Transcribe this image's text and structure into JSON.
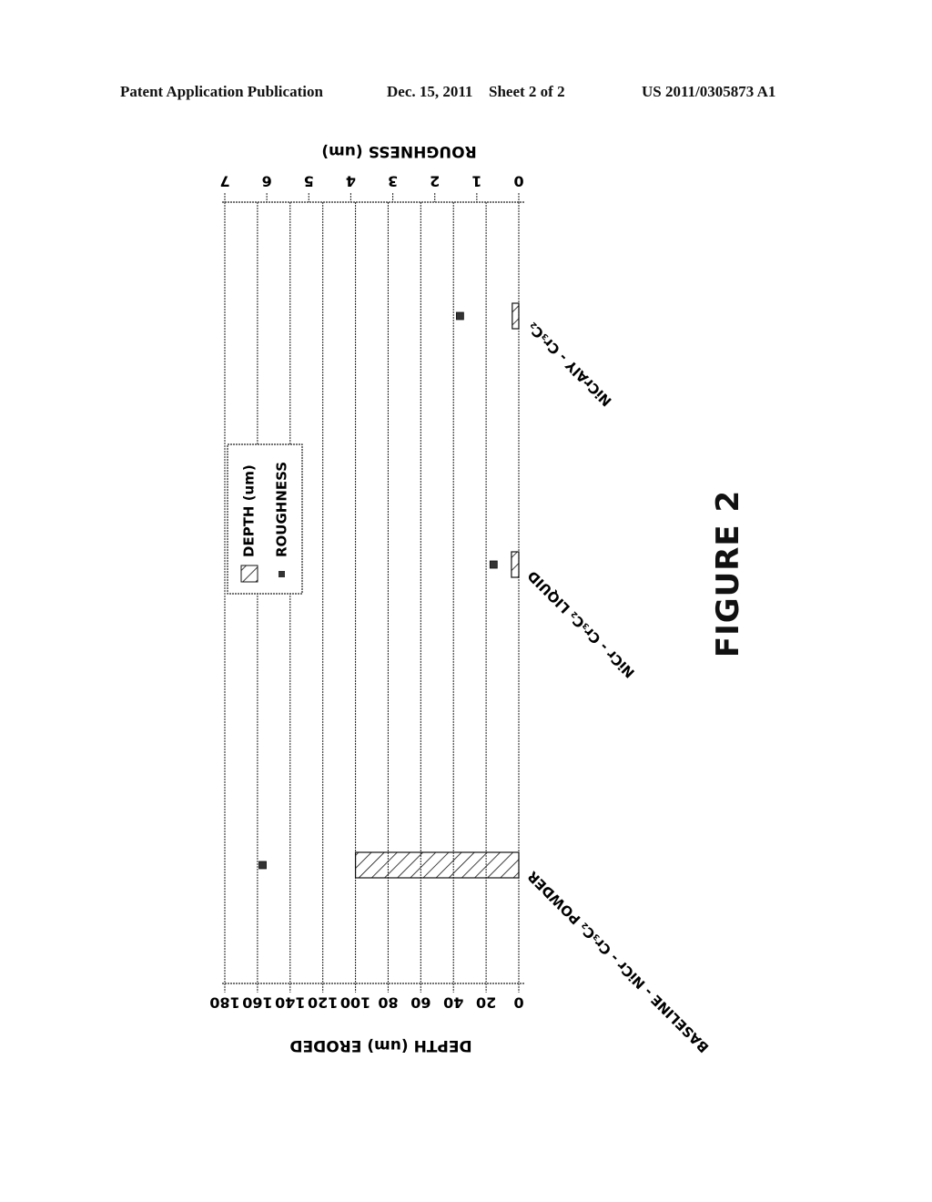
{
  "header": {
    "left": "Patent Application Publication",
    "date": "Dec. 15, 2011",
    "sheet": "Sheet 2 of 2",
    "pub_number": "US 2011/0305873 A1"
  },
  "figure_label": "FIGURE 2",
  "chart_data": {
    "type": "bar",
    "orientation": "rotated-90 (bars horizontal on page, axes on top/bottom)",
    "categories": [
      "BASELINE - NiCr - Cr3C2 POWDER",
      "NiCr - Cr3C2 LIQUID",
      "NiCrAlY - Cr3C2"
    ],
    "category_labels_display": [
      "BASELINE - NiCr - Cr₃C₂ POWDER",
      "NiCr - Cr₃C₂ LIQUID",
      "NiCrAlY - Cr₃C₂"
    ],
    "series": [
      {
        "name": "DEPTH (um)",
        "type": "bar",
        "axis": "primary",
        "pattern": "diagonal-hatch",
        "values": [
          100,
          4.5,
          4
        ]
      },
      {
        "name": "ROUGHNESS",
        "type": "scatter",
        "axis": "secondary",
        "marker": "square",
        "values": [
          6.1,
          0.6,
          1.4
        ]
      }
    ],
    "primary_axis": {
      "label": "DEPTH (um) ERODED",
      "range": [
        0,
        180
      ],
      "ticks": [
        0,
        20,
        40,
        60,
        80,
        100,
        120,
        140,
        160,
        180
      ]
    },
    "secondary_axis": {
      "label": "ROUGHNESS (um)",
      "range": [
        0,
        7
      ],
      "ticks": [
        0,
        1,
        2,
        3,
        4,
        5,
        6,
        7
      ]
    },
    "grid": true,
    "legend": {
      "placement": "center-top (rotated)",
      "entries": [
        "DEPTH (um)",
        "ROUGHNESS"
      ]
    }
  }
}
